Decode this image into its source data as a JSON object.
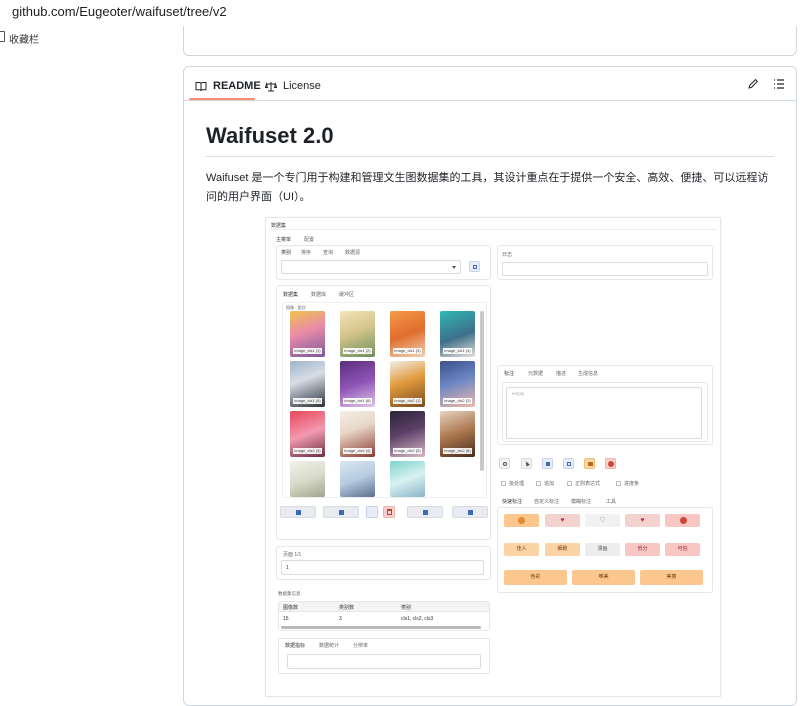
{
  "browser": {
    "url": "github.com/Eugeoter/waifuset/tree/v2",
    "bookmarks_label": "收藏栏"
  },
  "readme": {
    "tabs": [
      {
        "label": "README",
        "icon": "book-icon"
      },
      {
        "label": "License",
        "icon": "scale-icon"
      }
    ],
    "title": "Waifuset 2.0",
    "description": "Waifuset 是一个专门用于构建和管理文生图数据集的工具，其设计重点在于提供一个安全、高效、便捷、可以远程访问的用户界面（UI）。"
  },
  "app": {
    "header": "数据集",
    "main_tabs": [
      "主菜单",
      "配置"
    ],
    "filter_tabs": [
      "类别",
      "排序",
      "查询",
      "数据源"
    ],
    "log_label": "日志",
    "view_tabs": [
      "数据集",
      "数据库",
      "缓冲区"
    ],
    "gallery_label": "图像 · 类别",
    "images": [
      "image_cls1 (1)",
      "image_cls1 (2)",
      "image_cls1 (3)",
      "image_cls1 (4)",
      "image_cls1 (5)",
      "image_cls1 (6)",
      "image_cls2 (1)",
      "image_cls2 (2)",
      "image_cls2 (3)",
      "image_cls2 (4)",
      "image_cls2 (5)",
      "image_cls2 (6)",
      "",
      "",
      ""
    ],
    "caption_tabs": [
      "标注",
      "元数据",
      "描述",
      "生成信息"
    ],
    "caption_placeholder": "empty",
    "options": [
      "批处理",
      "追加",
      "正则表达式",
      "进度条"
    ],
    "quick_tabs": [
      "快速标注",
      "自定义标注",
      "模糊标注",
      "工具"
    ],
    "quick_row2": [
      "佳人",
      "细致",
      "漫画",
      "低分",
      "可怕"
    ],
    "quick_row3": [
      "色彩",
      "唯美",
      "美丽"
    ],
    "page_label": "页面 1/1",
    "page_value": "1",
    "dataset_info_label": "数据集信息",
    "table_headers": [
      "图像数",
      "类别数",
      "类别"
    ],
    "table_row": [
      "15",
      "3",
      "cls1, cls2, cls3"
    ],
    "bottom_tabs": [
      "数据指标",
      "数据统计",
      "分辨率"
    ],
    "colors": {
      "accent_orange": "#fbc78f",
      "accent_red": "#f8c6c3",
      "nav_blue": "#3b6bb3"
    }
  }
}
